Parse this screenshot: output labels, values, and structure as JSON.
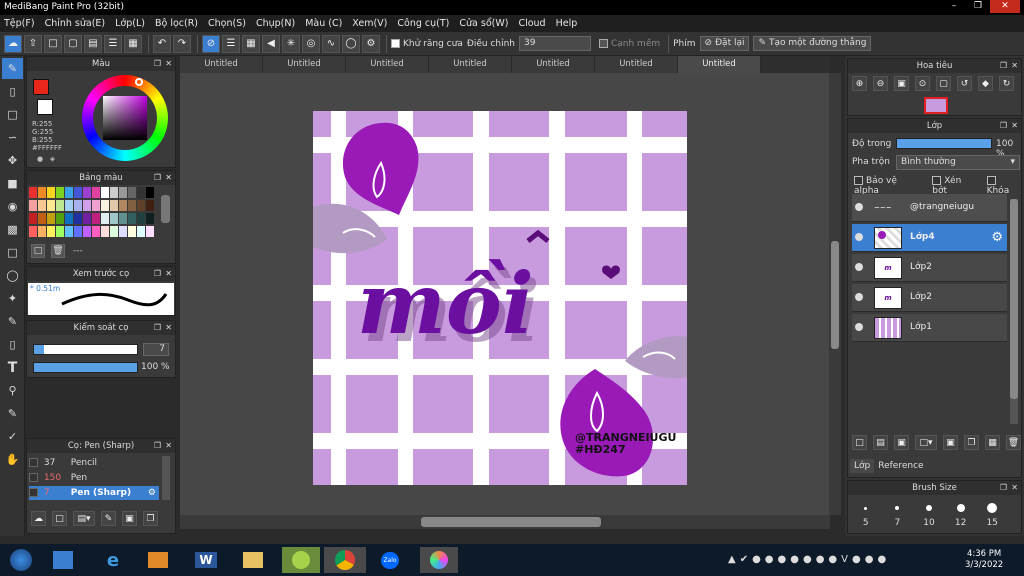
{
  "app": {
    "title": "MediBang Paint Pro (32bit)",
    "menu": [
      "Tệp(F)",
      "Chỉnh sửa(E)",
      "Lớp(L)",
      "Bộ lọc(R)",
      "Chọn(S)",
      "Chụp(N)",
      "Màu (C)",
      "Xem(V)",
      "Công cụ(T)",
      "Cửa sổ(W)",
      "Cloud",
      "Help"
    ]
  },
  "toolbar": {
    "antialias_label": "Khử răng cưa",
    "adjust_label": "Điều chỉnh",
    "adjust_value": "39",
    "edge_label": "Cạnh mềm",
    "key_label": "Phím",
    "reset_label": "Đặt lại",
    "ruler_label": "Tạo một đường thẳng"
  },
  "tabs": [
    "Untitled",
    "Untitled",
    "Untitled",
    "Untitled",
    "Untitled",
    "Untitled",
    "Untitled"
  ],
  "color_panel": {
    "title": "Màu",
    "r_value": "R:255",
    "g_value": "G:255",
    "b_value": "B:255",
    "hex": "#FFFFFF",
    "fg_color": "#e8261b",
    "bg_color": "#ffffff"
  },
  "palette_panel": {
    "title": "Bảng màu",
    "more": "---"
  },
  "preview_panel": {
    "title": "Xem trước cọ",
    "size": "0.51m"
  },
  "control_panel": {
    "title": "Kiểm soát cọ",
    "size_value": "7",
    "opacity_value": "100 %",
    "opacity_level": 1.0
  },
  "brush_panel": {
    "title": "Cọ: Pen (Sharp)",
    "items": [
      {
        "size": "37",
        "name": "Pencil"
      },
      {
        "size": "150",
        "name": "Pen"
      },
      {
        "size": "7",
        "name": "Pen (Sharp)"
      }
    ]
  },
  "navigator_panel": {
    "title": "Hoa tiêu"
  },
  "layer_panel": {
    "title": "Lớp",
    "opacity_label": "Độ trong",
    "opacity_value": "100 %",
    "blend_label": "Pha trộn",
    "blend_value": "Bình thường",
    "protect_alpha": "Bảo vệ alpha",
    "clip": "Xén bớt",
    "lock": "Khóa",
    "layers": [
      {
        "name": "@trangneiugu"
      },
      {
        "name": "Lớp4"
      },
      {
        "name": "Lớp2"
      },
      {
        "name": "Lớp2"
      },
      {
        "name": "Lớp1"
      }
    ],
    "tab_layer": "Lớp",
    "tab_reference": "Reference"
  },
  "brush_size_panel": {
    "title": "Brush Size",
    "sizes": [
      "5",
      "7",
      "10",
      "12",
      "15"
    ]
  },
  "artwork": {
    "word": "mồi",
    "credit_line1": "@TRANGNEIUGU",
    "credit_line2": "#HĐ247"
  },
  "taskbar": {
    "time": "4:36 PM",
    "date": "3/3/2022",
    "zalo_label": "Zalo"
  }
}
